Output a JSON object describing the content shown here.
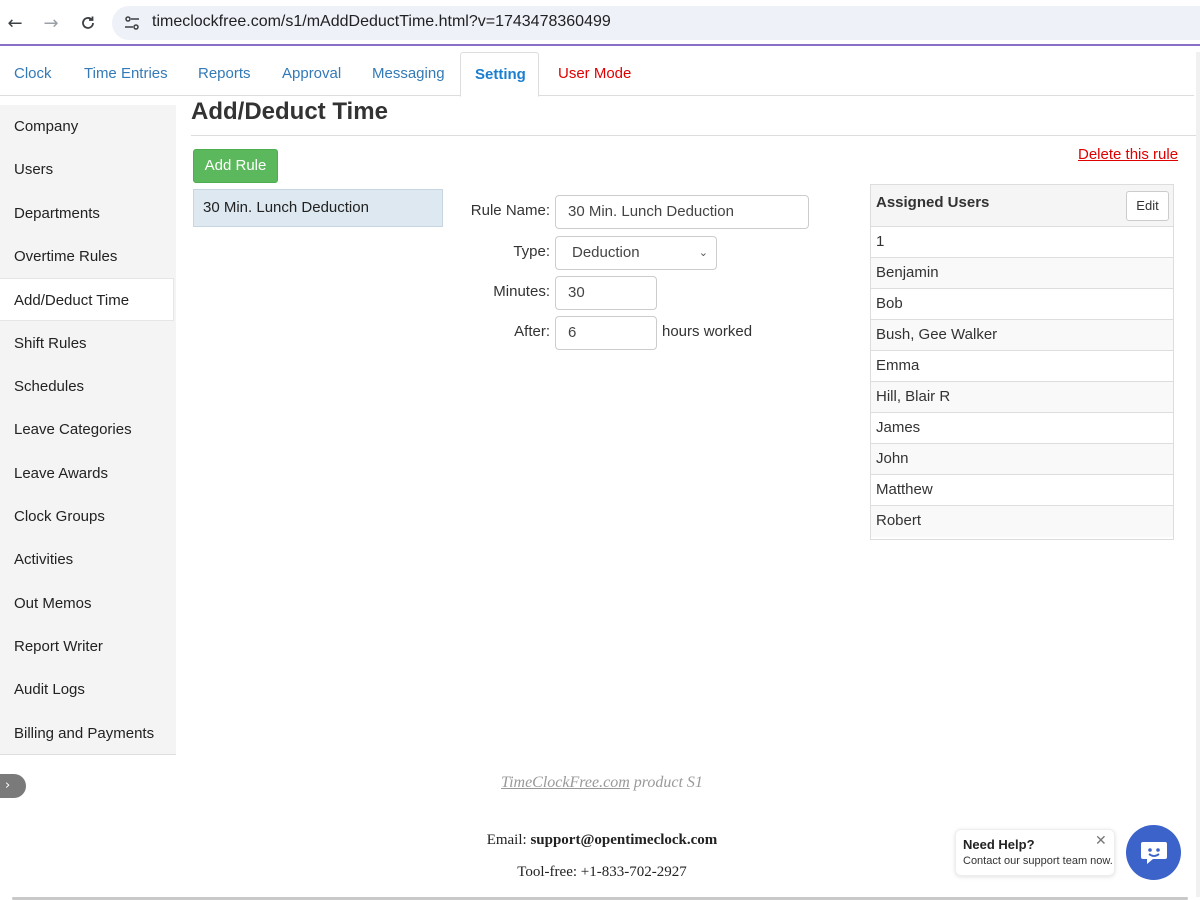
{
  "browser": {
    "url": "timeclockfree.com/s1/mAddDeductTime.html?v=1743478360499",
    "icons": {
      "back": "arrow-left-icon",
      "forward": "arrow-right-icon",
      "reload": "reload-icon",
      "site_info": "tune-icon"
    }
  },
  "tabs": [
    {
      "label": "Clock"
    },
    {
      "label": "Time Entries"
    },
    {
      "label": "Reports"
    },
    {
      "label": "Approval"
    },
    {
      "label": "Messaging"
    },
    {
      "label": "Setting",
      "active": true
    },
    {
      "label": "User Mode"
    }
  ],
  "sidebar": {
    "items": [
      {
        "label": "Company"
      },
      {
        "label": "Users"
      },
      {
        "label": "Departments"
      },
      {
        "label": "Overtime Rules"
      },
      {
        "label": "Add/Deduct Time",
        "active": true
      },
      {
        "label": "Shift Rules"
      },
      {
        "label": "Schedules"
      },
      {
        "label": "Leave Categories"
      },
      {
        "label": "Leave Awards"
      },
      {
        "label": "Clock Groups"
      },
      {
        "label": "Activities"
      },
      {
        "label": "Out Memos"
      },
      {
        "label": "Report Writer"
      },
      {
        "label": "Audit Logs"
      },
      {
        "label": "Billing and Payments"
      }
    ],
    "toggle_icon": "chevron-right-icon"
  },
  "main": {
    "title": "Add/Deduct Time",
    "add_rule_label": "Add Rule",
    "delete_rule_label": "Delete this rule",
    "rules": [
      {
        "name": "30 Min. Lunch Deduction",
        "selected": true
      }
    ],
    "form": {
      "rule_name_label": "Rule Name:",
      "rule_name_value": "30 Min. Lunch Deduction",
      "type_label": "Type:",
      "type_value": "Deduction",
      "minutes_label": "Minutes:",
      "minutes_value": "30",
      "after_label": "After:",
      "after_value": "6",
      "after_suffix": "hours worked"
    }
  },
  "assigned_users": {
    "title": "Assigned Users",
    "edit_label": "Edit",
    "users": [
      "1",
      "Benjamin",
      "Bob",
      "Bush, Gee Walker",
      "Emma",
      "Hill, Blair R",
      "James",
      "John",
      "Matthew",
      "Robert"
    ]
  },
  "footer": {
    "brand": "TimeClockFree.com",
    "product_suffix": " product S1",
    "email_label": "Email: ",
    "email": "support@opentimeclock.com",
    "phone": "Tool-free: +1-833-702-2927"
  },
  "help_widget": {
    "title": "Need Help?",
    "subtitle": "Contact our support team now.",
    "close_icon": "close-icon",
    "chat_icon": "chat-bubble-icon"
  },
  "colors": {
    "accent_blue": "#337ab7",
    "active_tab_blue": "#1a7fd0",
    "user_mode_red": "#e00000",
    "add_button_green": "#5cb85c",
    "chat_blue": "#3b63c9",
    "selected_rule_bg": "#dde8f0"
  }
}
